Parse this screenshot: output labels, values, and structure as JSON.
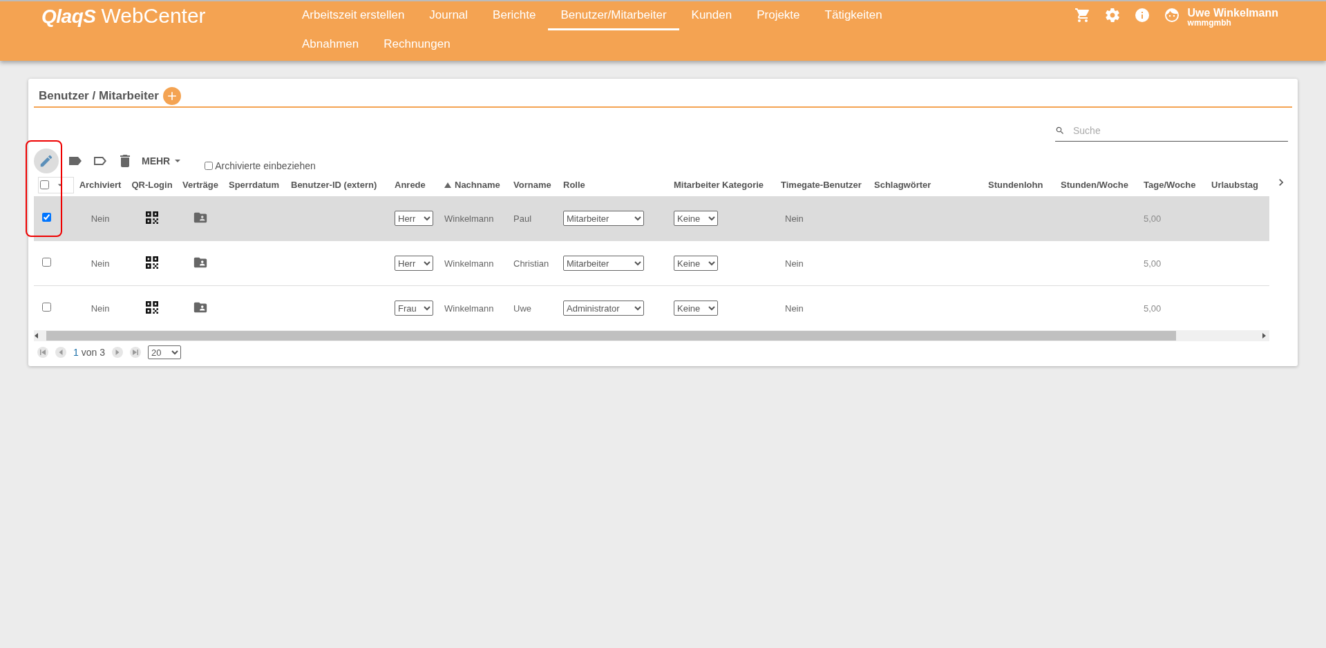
{
  "header": {
    "logo_mark": "QlaqS",
    "logo_text": "WebCenter",
    "nav": [
      {
        "label": "Arbeitszeit erstellen",
        "selected": false
      },
      {
        "label": "Journal",
        "selected": false
      },
      {
        "label": "Berichte",
        "selected": false
      },
      {
        "label": "Benutzer/Mitarbeiter",
        "selected": true
      },
      {
        "label": "Kunden",
        "selected": false
      },
      {
        "label": "Projekte",
        "selected": false
      },
      {
        "label": "Tätigkeiten",
        "selected": false
      },
      {
        "label": "Abnahmen",
        "selected": false
      },
      {
        "label": "Rechnungen",
        "selected": false
      }
    ],
    "user": {
      "name": "Uwe Winkelmann",
      "company": "wmmgmbh"
    }
  },
  "panel": {
    "title": "Benutzer / Mitarbeiter",
    "search": {
      "placeholder": "Suche"
    },
    "toolbar": {
      "more_label": "MEHR",
      "include_archived": {
        "label": "Archivierte einbeziehen",
        "checked": false
      }
    },
    "table": {
      "select_all": {
        "checked": false
      },
      "columns": [
        {
          "label": "Archiviert",
          "sorted": false
        },
        {
          "label": "QR-Login",
          "sorted": false
        },
        {
          "label": "Verträge",
          "sorted": false
        },
        {
          "label": "Sperrdatum",
          "sorted": false
        },
        {
          "label": "Benutzer-ID (extern)",
          "sorted": false
        },
        {
          "label": "Anrede",
          "sorted": false
        },
        {
          "label": "Nachname",
          "sorted": true
        },
        {
          "label": "Vorname",
          "sorted": false
        },
        {
          "label": "Rolle",
          "sorted": false
        },
        {
          "label": "Mitarbeiter Kategorie",
          "sorted": false
        },
        {
          "label": "Timegate-Benutzer",
          "sorted": false
        },
        {
          "label": "Schlagwörter",
          "sorted": false
        },
        {
          "label": "Stundenlohn",
          "sorted": false
        },
        {
          "label": "Stunden/Woche",
          "sorted": false
        },
        {
          "label": "Tage/Woche",
          "sorted": false
        },
        {
          "label": "Urlaubstag",
          "sorted": false
        }
      ],
      "rows": [
        {
          "selected": true,
          "archiviert": "Nein",
          "anrede": "Herr",
          "nachname": "Winkelmann",
          "vorname": "Paul",
          "rolle": "Mitarbeiter",
          "kategorie": "Keine",
          "timegate": "Nein",
          "tage_woche": "5,00"
        },
        {
          "selected": false,
          "archiviert": "Nein",
          "anrede": "Herr",
          "nachname": "Winkelmann",
          "vorname": "Christian",
          "rolle": "Mitarbeiter",
          "kategorie": "Keine",
          "timegate": "Nein",
          "tage_woche": "5,00"
        },
        {
          "selected": false,
          "archiviert": "Nein",
          "anrede": "Frau",
          "nachname": "Winkelmann",
          "vorname": "Uwe",
          "rolle": "Administrator",
          "kategorie": "Keine",
          "timegate": "Nein",
          "tage_woche": "5,00"
        }
      ]
    },
    "pager": {
      "current": "1",
      "total": "von 3",
      "page_size": "20"
    }
  }
}
